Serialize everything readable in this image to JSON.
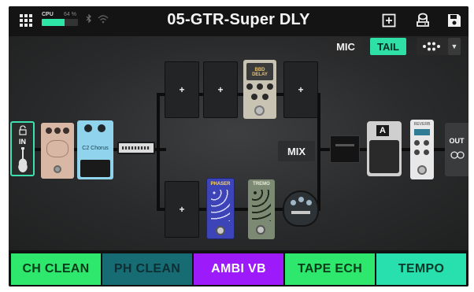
{
  "topbar": {
    "menu_icon": "grid-menu-icon",
    "cpu_label": "CPU",
    "cpu_percent_text": "64 %",
    "cpu_usage_fraction": 0.64,
    "bluetooth_icon": "bluetooth-icon",
    "wifi_icon": "wifi-icon",
    "preset_title": "05-GTR-Super DLY",
    "icons": [
      "add-block-icon",
      "save-alt-icon",
      "save-icon"
    ]
  },
  "signal_chain": {
    "mic_label": "MIC",
    "tail_label": "TAIL",
    "mix_label": "MIX",
    "in_label": "IN",
    "out_label": "OUT",
    "empty_slot_symbol": "+",
    "amp_model_letter": "A",
    "blocks": [
      {
        "name": "Super Drive pedal",
        "color": "#d8b8a5"
      },
      {
        "name": "C2 Chorus",
        "text": "C2 Chorus",
        "color": "#8fd3ec"
      },
      {
        "name": "BBD Delay",
        "text": "BBD DELAY",
        "color": "#c9c3b4"
      },
      {
        "name": "Phaser",
        "text": "PHASER",
        "color": "#3d44b8"
      },
      {
        "name": "Tremolo",
        "text": "TREMO",
        "color": "#7c8a74"
      },
      {
        "name": "Reverb",
        "text": "REVERB",
        "color": "#e8e8e8"
      }
    ]
  },
  "snapshots": [
    {
      "label": "CH CLEAN",
      "bg": "#2ee86e",
      "fg": "#073b19"
    },
    {
      "label": "PH CLEAN",
      "bg": "#176b73",
      "fg": "#0e2f33"
    },
    {
      "label": "AMBI VB",
      "bg": "#9d1bfa",
      "fg": "#ffffff"
    },
    {
      "label": "TAPE ECH",
      "bg": "#2ee86e",
      "fg": "#073b19"
    },
    {
      "label": "TEMPO",
      "bg": "#27e0ad",
      "fg": "#063a2a"
    }
  ],
  "colors": {
    "accent": "#2ee0a6",
    "background": "#1e1f20"
  }
}
